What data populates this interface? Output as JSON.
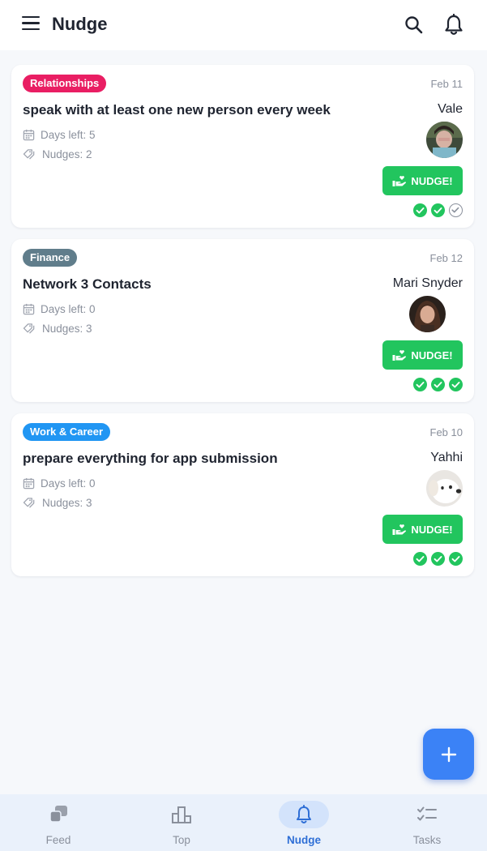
{
  "app": {
    "title": "Nudge"
  },
  "colors": {
    "accent": "#3b82f6",
    "nudge_green": "#22c55e",
    "relationships": "#e91e63",
    "finance": "#607d8b",
    "work": "#2196f3"
  },
  "icons": {
    "menu": "menu-icon",
    "search": "search-icon",
    "bell": "bell-icon",
    "calendar": "calendar-icon",
    "tag": "tag-icon",
    "nudge": "hand-heart-icon",
    "check": "check-circle-icon",
    "add": "plus-icon"
  },
  "cards": [
    {
      "category": "Relationships",
      "date": "Feb 11",
      "goal": "speak with at least one new person every week",
      "days_left": "Days left: 5",
      "nudges": "Nudges: 2",
      "person": "Vale",
      "nudge_label": "NUDGE!",
      "checks": [
        "done",
        "done",
        "pending"
      ]
    },
    {
      "category": "Finance",
      "date": "Feb 12",
      "goal": "Network 3 Contacts",
      "days_left": "Days left: 0",
      "nudges": "Nudges: 3",
      "person": "Mari Snyder",
      "nudge_label": "NUDGE!",
      "checks": [
        "done",
        "done",
        "done"
      ]
    },
    {
      "category": "Work & Career",
      "date": "Feb 10",
      "goal": "prepare everything for app submission",
      "days_left": "Days left: 0",
      "nudges": "Nudges: 3",
      "person": "Yahhi",
      "nudge_label": "NUDGE!",
      "checks": [
        "done",
        "done",
        "done"
      ]
    }
  ],
  "nav": {
    "items": [
      {
        "label": "Feed"
      },
      {
        "label": "Top"
      },
      {
        "label": "Nudge"
      },
      {
        "label": "Tasks"
      }
    ],
    "active": "Nudge"
  }
}
